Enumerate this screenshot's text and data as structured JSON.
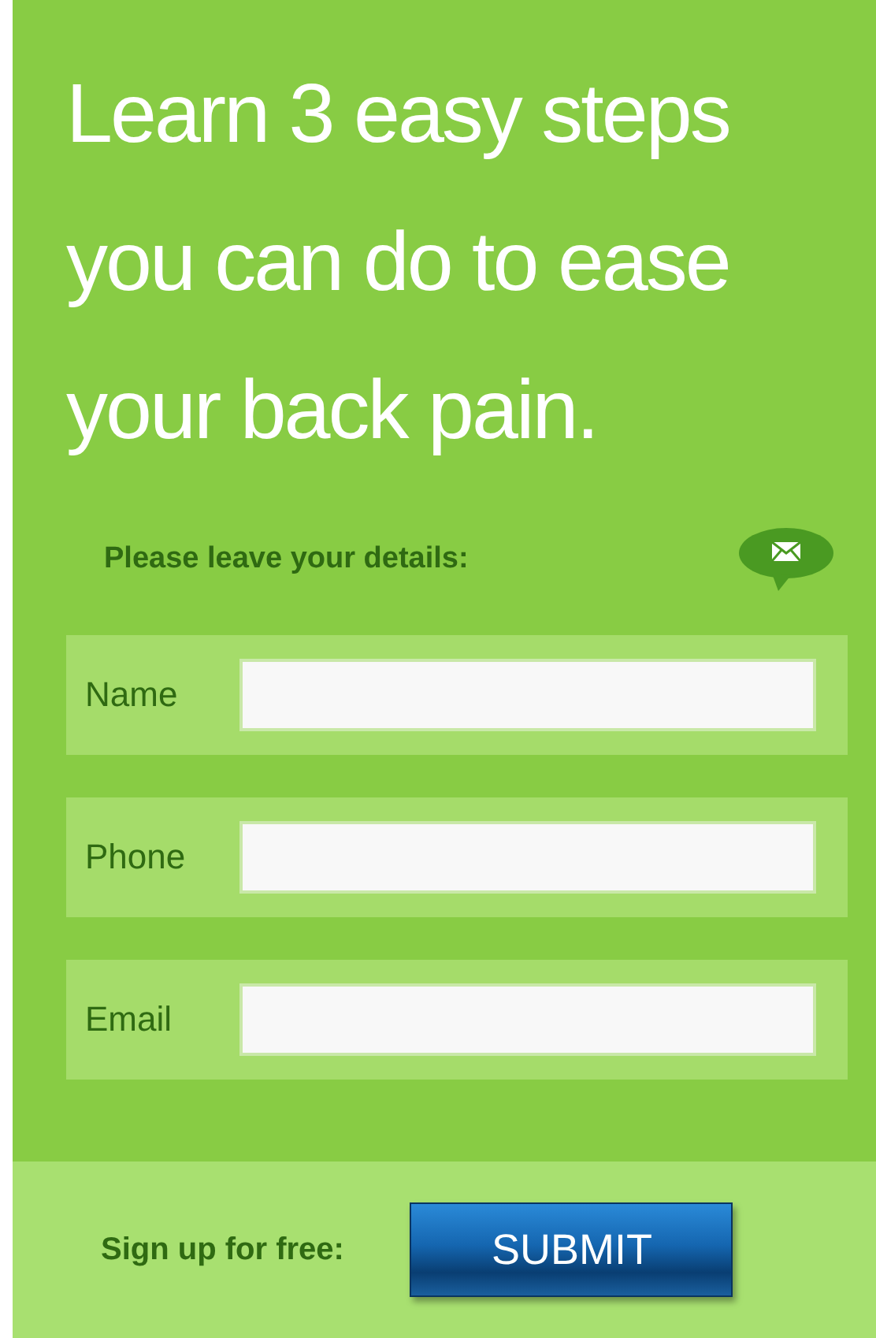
{
  "headline": "Learn 3 easy steps you can do to ease your back pain.",
  "prompt": "Please leave your details:",
  "fields": [
    {
      "label": "Name"
    },
    {
      "label": "Phone"
    },
    {
      "label": "Email"
    }
  ],
  "footer": {
    "label": "Sign up for free:",
    "button": "SUBMIT"
  }
}
